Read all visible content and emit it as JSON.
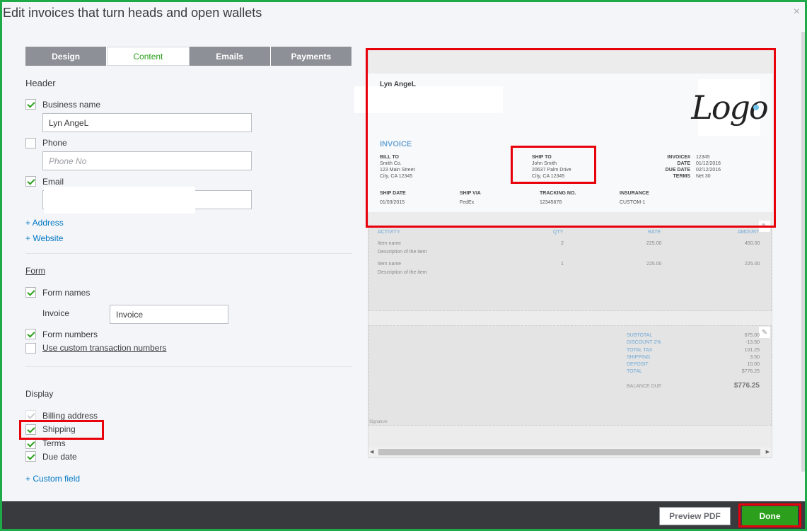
{
  "title": "Edit invoices that turn heads and open wallets",
  "close_glyph": "×",
  "tabs": [
    {
      "label": "Design"
    },
    {
      "label": "Content"
    },
    {
      "label": "Emails"
    },
    {
      "label": "Payments"
    }
  ],
  "active_tab": "Content",
  "header_section": {
    "label": "Header",
    "business_name": {
      "label": "Business name",
      "checked": true,
      "value": "Lyn AngeL"
    },
    "phone": {
      "label": "Phone",
      "checked": false,
      "placeholder": "Phone No"
    },
    "email": {
      "label": "Email",
      "checked": true,
      "value": ""
    },
    "add_address": "+ Address",
    "add_website": "+ Website"
  },
  "form_section": {
    "label": "Form",
    "form_names": {
      "label": "Form names",
      "checked": true
    },
    "invoice_label": "Invoice",
    "invoice_value": "Invoice",
    "form_numbers": {
      "label": "Form numbers",
      "checked": true
    },
    "custom_numbers": {
      "label": "Use custom transaction numbers",
      "checked": false
    }
  },
  "display_section": {
    "label": "Display",
    "items": [
      {
        "label": "Billing address",
        "checked": true,
        "faint": true
      },
      {
        "label": "Shipping",
        "checked": true
      },
      {
        "label": "Terms",
        "checked": true
      },
      {
        "label": "Due date",
        "checked": true
      }
    ],
    "add_custom_field": "+ Custom field"
  },
  "preview": {
    "company": "Lyn AngeL",
    "logo_text": "Logo",
    "invoice_heading": "INVOICE",
    "bill_to": {
      "heading": "BILL TO",
      "lines": [
        "Smith Co.",
        "123 Main Street",
        "City, CA 12345"
      ]
    },
    "ship_to": {
      "heading": "SHIP TO",
      "lines": [
        "John Smith",
        "20637 Palm Drive",
        "City, CA 12345"
      ]
    },
    "meta": [
      {
        "label": "INVOICE#",
        "value": "12345"
      },
      {
        "label": "DATE",
        "value": "01/12/2016"
      },
      {
        "label": "DUE DATE",
        "value": "02/12/2016"
      },
      {
        "label": "TERMS",
        "value": "Net 30"
      }
    ],
    "shipping_fields": [
      {
        "label": "SHIP DATE",
        "value": "01/03/2015"
      },
      {
        "label": "SHIP VIA",
        "value": "FedEx"
      },
      {
        "label": "TRACKING NO.",
        "value": "12345678"
      },
      {
        "label": "INSURANCE",
        "value": "CUSTOM-1"
      }
    ],
    "table_headers": {
      "activity": "ACTIVITY",
      "qty": "QTY",
      "rate": "RATE",
      "amount": "AMOUNT"
    },
    "rows": [
      {
        "name": "Item name",
        "desc": "Description of the item",
        "qty": "2",
        "rate": "225.00",
        "amount": "450.00"
      },
      {
        "name": "Item name",
        "desc": "Description of the item",
        "qty": "1",
        "rate": "225.00",
        "amount": "225.00"
      }
    ],
    "totals": [
      {
        "label": "SUBTOTAL",
        "value": "675.00"
      },
      {
        "label": "DISCOUNT 2%",
        "value": "-13.50"
      },
      {
        "label": "TOTAL TAX",
        "value": "101.25"
      },
      {
        "label": "SHIPPING",
        "value": "3.50"
      },
      {
        "label": "DEPOSIT",
        "value": "10.00"
      },
      {
        "label": "TOTAL",
        "value": "$776.25"
      }
    ],
    "balance_due": {
      "label": "BALANCE DUE",
      "value": "$776.25"
    },
    "signature": "Signature"
  },
  "footer": {
    "preview_pdf": "Preview PDF",
    "done": "Done"
  }
}
